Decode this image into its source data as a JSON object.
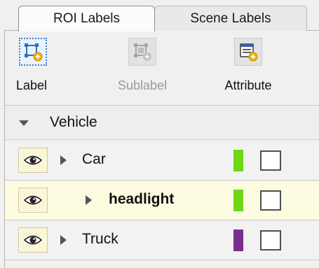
{
  "tabs": [
    {
      "label": "ROI Labels",
      "active": true
    },
    {
      "label": "Scene Labels",
      "active": false
    }
  ],
  "toolbar": {
    "label_button": {
      "label": "Label",
      "icon": "roi-label-add-icon",
      "enabled": true
    },
    "sublabel_button": {
      "label": "Sublabel",
      "icon": "sublabel-add-icon",
      "enabled": false
    },
    "attribute_button": {
      "label": "Attribute",
      "icon": "attribute-add-icon",
      "enabled": true
    }
  },
  "group": {
    "label": "Vehicle",
    "expanded": true
  },
  "labels": [
    {
      "name": "Car",
      "color": "#6fd615",
      "level": 0,
      "visible": true,
      "checked": false
    },
    {
      "name": "headlight",
      "color": "#6fd615",
      "level": 1,
      "visible": true,
      "checked": false,
      "selected": true
    },
    {
      "name": "Truck",
      "color": "#7a2f8c",
      "level": 0,
      "visible": true,
      "checked": false
    }
  ],
  "colors": {
    "accent": "#3c7ccf",
    "selected_row": "#fdfbe0",
    "eye_bg": "#fbf6d8"
  }
}
